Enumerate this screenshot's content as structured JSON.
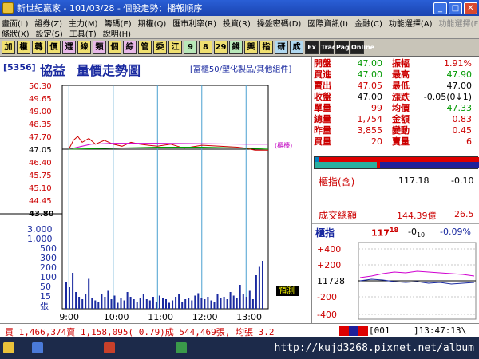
{
  "window": {
    "title": "新世紀贏家 - 101/03/28 - 個股走勢：播報順序"
  },
  "menu": {
    "row1": [
      "畫面(L)",
      "證券(Z)",
      "主力(M)",
      "籌碼(E)",
      "期權(Q)",
      "匯市利率(R)",
      "投資(R)",
      "操盤密碼(D)",
      "國際資訊(I)",
      "金融(C)",
      "功能選擇(A)",
      "功能選擇(F)"
    ],
    "row2": [
      "條狀(X)",
      "設定(S)",
      "工具(T)",
      "說明(H)"
    ]
  },
  "toolbar": {
    "buttons": [
      {
        "label": "加",
        "style": "y"
      },
      {
        "label": "權",
        "style": "y"
      },
      {
        "label": "轉",
        "style": "y"
      },
      {
        "label": "價",
        "style": "y"
      },
      {
        "label": "選",
        "style": "p"
      },
      {
        "label": "線",
        "style": "y"
      },
      {
        "label": "類",
        "style": "p"
      },
      {
        "label": "個",
        "style": "y"
      },
      {
        "label": "綜",
        "style": "p"
      },
      {
        "label": "管",
        "style": "y"
      },
      {
        "label": "委",
        "style": "y"
      },
      {
        "label": "江",
        "style": "y"
      },
      {
        "label": "9",
        "style": "g"
      },
      {
        "label": "8",
        "style": "y"
      },
      {
        "label": "29",
        "style": "y"
      },
      {
        "label": "錢",
        "style": "g"
      },
      {
        "label": "興",
        "style": "y"
      },
      {
        "label": "指",
        "style": "y"
      },
      {
        "label": "研",
        "style": "c"
      },
      {
        "label": "成",
        "style": "c"
      },
      {
        "label": "Ex",
        "style": "k"
      },
      {
        "label": "Trade",
        "style": "k"
      },
      {
        "label": "Page",
        "style": "k"
      },
      {
        "label": "Online",
        "style": "k"
      }
    ]
  },
  "stock": {
    "code": "[5356]",
    "name": "協益",
    "chart_title": "量價走勢圖",
    "category": "[富櫃50/塑化製品/其他組件]"
  },
  "chart_data": [
    {
      "type": "line",
      "title": "量價走勢圖",
      "xlabel": "",
      "ylabel": "",
      "x_ticks": [
        "9:00",
        "10:00",
        "11:00",
        "12:00",
        "13:00"
      ],
      "y_ticks": [
        "50.30",
        "49.65",
        "49.00",
        "48.35",
        "47.70",
        "47.05",
        "46.40",
        "45.75",
        "45.10",
        "44.45",
        "43.80"
      ],
      "ylim": [
        43.8,
        50.3
      ],
      "reference_price": 47.05,
      "reference_label": "(櫃檯)",
      "series": [
        {
          "color": "#d00000",
          "x": [
            9.0,
            9.1,
            9.2,
            9.3,
            9.45,
            9.6,
            9.8,
            10.0,
            10.2,
            10.4,
            10.6,
            10.8,
            11.0,
            11.3,
            11.6,
            12.0,
            12.4,
            12.8,
            13.0,
            13.2,
            13.5
          ],
          "y": [
            47.05,
            47.5,
            47.7,
            47.4,
            47.6,
            47.3,
            47.5,
            47.3,
            47.2,
            47.4,
            47.3,
            47.25,
            47.2,
            47.3,
            47.1,
            47.25,
            47.2,
            47.15,
            47.1,
            47.0,
            47.0
          ]
        },
        {
          "color": "#d000d0",
          "x": [
            9.0,
            9.5,
            10.0,
            11.0,
            12.0,
            13.0,
            13.5
          ],
          "y": [
            47.05,
            47.3,
            47.35,
            47.35,
            47.33,
            47.3,
            47.3
          ]
        },
        {
          "color": "#00a000",
          "x": [
            9.0,
            10.0,
            11.0,
            12.0,
            13.0,
            13.5
          ],
          "y": [
            47.05,
            47.1,
            47.15,
            47.15,
            47.1,
            47.05
          ]
        }
      ]
    },
    {
      "type": "bar",
      "title": "",
      "xlabel": "",
      "ylabel": "張",
      "y_ticks": [
        "3,000",
        "1,000",
        "500",
        "300",
        "200",
        "100",
        "50",
        "15",
        "張"
      ],
      "label": "預測",
      "values": [
        22,
        18,
        30,
        14,
        10,
        8,
        12,
        25,
        9,
        7,
        6,
        12,
        10,
        15,
        8,
        11,
        5,
        9,
        7,
        14,
        10,
        8,
        6,
        9,
        12,
        8,
        7,
        10,
        6,
        11,
        9,
        8,
        5,
        7,
        10,
        12,
        6,
        8,
        9,
        7,
        11,
        13,
        9,
        8,
        10,
        7,
        6,
        12,
        9,
        10,
        8,
        14,
        11,
        9,
        20,
        12,
        10,
        15,
        8,
        28,
        35,
        40
      ]
    },
    {
      "type": "line",
      "title": "",
      "xlabel": "",
      "ylabel": "",
      "y_ticks": [
        "+400",
        "+200",
        "11728",
        "-200",
        "-400"
      ],
      "ylim": [
        -450,
        450
      ],
      "series": [
        {
          "color": "#d000d0",
          "x": [
            0,
            1,
            2,
            3,
            4,
            5,
            6,
            7,
            8,
            9,
            10
          ],
          "y": [
            40,
            60,
            90,
            110,
            100,
            120,
            110,
            100,
            90,
            80,
            60
          ]
        },
        {
          "color": "#1a2aa0",
          "x": [
            0,
            1,
            2,
            3,
            4,
            5,
            6,
            7,
            8,
            9,
            10
          ],
          "y": [
            0,
            20,
            10,
            -10,
            -20,
            -10,
            -30,
            -20,
            -40,
            -30,
            -20
          ]
        }
      ]
    }
  ],
  "quote": {
    "rows": [
      {
        "l1": "開盤",
        "v1": "47.00",
        "v1c": "green",
        "l2": "振幅",
        "v2": "1.91%",
        "v2c": "red"
      },
      {
        "l1": "買進",
        "v1": "47.00",
        "v1c": "green",
        "l2": "最高",
        "v2": "47.90",
        "v2c": "green"
      },
      {
        "l1": "賣出",
        "v1": "47.05",
        "v1c": "red",
        "l2": "最低",
        "v2": "47.00",
        "v2c": "black"
      },
      {
        "l1": "收盤",
        "v1": "47.00",
        "v1c": "black",
        "l2": "漲跌",
        "v2": "-0.05(0↓1)",
        "v2c": "black"
      },
      {
        "l1": "單量",
        "v1": "99",
        "v1c": "red",
        "l2": "均價",
        "v2": "47.33",
        "v2c": "green"
      },
      {
        "l1": "總量",
        "v1": "1,754",
        "v1c": "red",
        "l2": "金額",
        "v2": "0.83",
        "v2c": "red"
      },
      {
        "l1": "昨量",
        "v1": "3,855",
        "v1c": "red",
        "l2": "變動",
        "v2": "0.45",
        "v2c": "red"
      },
      {
        "l1": "買量",
        "v1": "20",
        "v1c": "red",
        "l2": "賣量",
        "v2": "6",
        "v2c": "red"
      }
    ],
    "index_label": "櫃指(含)",
    "index_value": "117.18",
    "index_change": "-0.10",
    "turnover_label": "成交總額",
    "turnover_value": "144.39億",
    "turnover_extra": "26.5",
    "mini_label": "櫃指",
    "mini_value": "117",
    "mini_value_sup": "18",
    "mini_change": "-0",
    "mini_change_sub": "10",
    "mini_pct": "-0.09%"
  },
  "status": {
    "summary": "買 1,466,374賣 1,158,095( 0.79)成 544,469張, 均張 3.2",
    "code": "[001",
    "clock": "]13:47:13\\"
  },
  "taskbar": {
    "watermark": "http://kujd3268.pixnet.net/album"
  }
}
